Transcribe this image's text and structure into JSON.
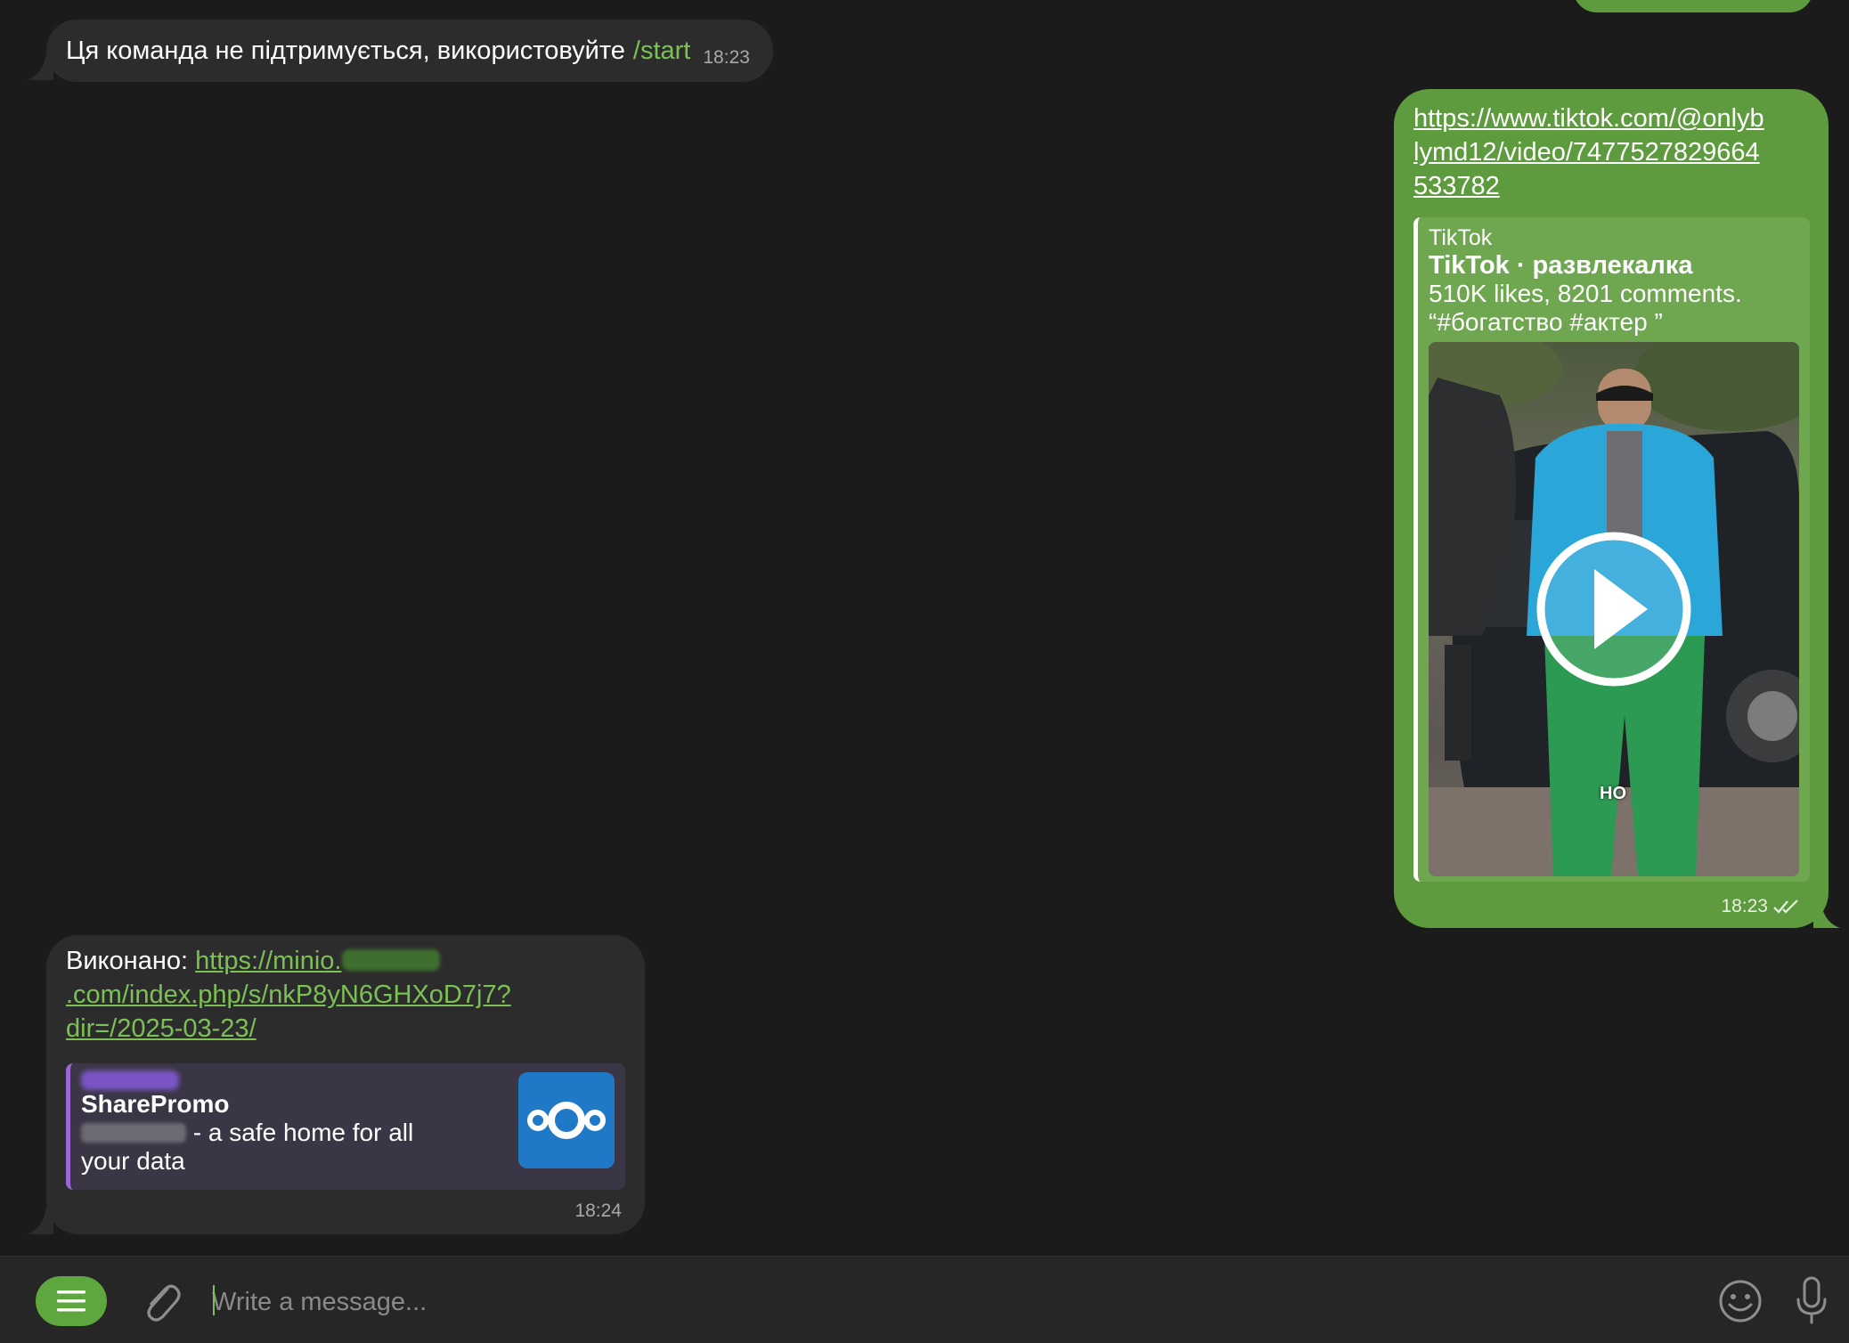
{
  "messages": {
    "unsupported": {
      "text": "Ця команда не підтримується, використовуйте",
      "command": "/start",
      "time": "18:23"
    },
    "tiktok": {
      "link": "https://www.tiktok.com/@onlyblymd12/video/7477527829664533782",
      "preview": {
        "site": "TikTok",
        "title": "TikTok · развлекалка",
        "description": "510K likes, 8201 comments. “#богатство #актер ”",
        "video_caption": "HO"
      },
      "time": "18:23",
      "status": "read"
    },
    "done": {
      "label": "Виконано:",
      "link_part1": "https://minio.",
      "link_part2": ".com/index.php/s/nkP8yN6GHXoD7j7?dir=/2025-03-23/",
      "preview": {
        "title": "SharePromo",
        "description": " - a safe home for all your data"
      },
      "time": "18:24"
    }
  },
  "composer": {
    "placeholder": "Write a message..."
  },
  "colors": {
    "background": "#1b1b1b",
    "incoming_bubble": "#2c2c2c",
    "outgoing_bubble": "#5e9a3e",
    "accent_green": "#7bc155",
    "preview_accent_purple": "#9b67d8",
    "nextcloud_blue": "#1f79c6"
  },
  "icons": {
    "menu": "menu-icon",
    "attach": "paperclip-icon",
    "emoji": "smile-icon",
    "mic": "microphone-icon",
    "play": "play-icon",
    "read": "double-check-icon",
    "logo": "nextcloud-logo-icon"
  }
}
